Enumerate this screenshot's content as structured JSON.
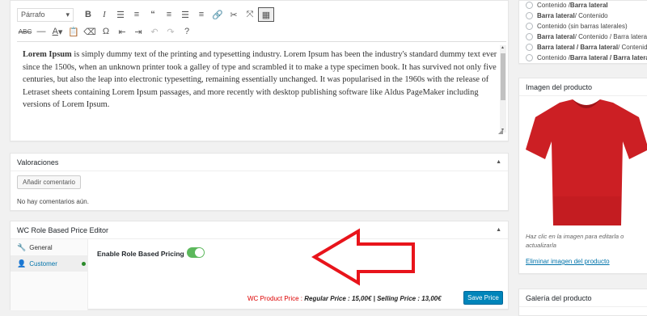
{
  "editor": {
    "format_select": "Párrafo",
    "content_bold": "Lorem Ipsum",
    "content_rest": " is simply dummy text of the printing and typesetting industry. Lorem Ipsum has been the industry's standard dummy text ever since the 1500s, when an unknown printer took a galley of type and scrambled it to make a type specimen book. It has survived not only five centuries, but also the leap into electronic typesetting, remaining essentially unchanged. It was popularised in the 1960s with the release of Letraset sheets containing Lorem Ipsum passages, and more recently with desktop publishing software like Aldus PageMaker including versions of Lorem Ipsum.",
    "toolbar_row1": [
      "bold-icon",
      "italic-icon",
      "bulleted-list-icon",
      "numbered-list-icon",
      "blockquote-icon",
      "align-left-icon",
      "align-center-icon",
      "align-right-icon",
      "link-icon",
      "unlink-icon",
      "fullscreen-icon",
      "toolbar-toggle-icon"
    ],
    "toolbar_row2": [
      "strikethrough-icon",
      "horizontal-line-icon",
      "text-color-icon",
      "paste-text-icon",
      "clear-formatting-icon",
      "special-char-icon",
      "outdent-icon",
      "indent-icon",
      "undo-icon",
      "redo-icon",
      "help-icon"
    ]
  },
  "reviews": {
    "title": "Valoraciones",
    "add_button": "Añadir comentario",
    "empty_text": "No hay comentarios aún."
  },
  "role_price": {
    "title": "WC Role Based Price Editor",
    "tabs": [
      {
        "label": "General",
        "icon": "wrench-icon"
      },
      {
        "label": "Customer",
        "icon": "user-icon"
      }
    ],
    "enable_label": "Enable Role Based Pricing",
    "enabled": true,
    "price_prefix": "WC Product Price : ",
    "price_detail": "Regular Price : 15,00€ | Selling Price : 13,00€",
    "save_button": "Save Price"
  },
  "templates": {
    "options": [
      {
        "a": "Contenido / ",
        "b": "Barra lateral"
      },
      {
        "a": "Barra lateral",
        "b": " / Contenido"
      },
      {
        "a": "Contenido (sin barras laterales)",
        "b": ""
      },
      {
        "a": "Barra lateral",
        "b": " / Contenido / Barra lateral"
      },
      {
        "a": "Barra lateral / Barra lateral",
        "b": " / Contenido"
      },
      {
        "a": "Contenido / ",
        "b": "Barra lateral / Barra lateral"
      }
    ]
  },
  "product_image": {
    "title": "Imagen del producto",
    "help_text": "Haz clic en la imagen para editarla o actualizarla",
    "remove_link": "Eliminar imagen del producto"
  },
  "gallery": {
    "title": "Galería del producto"
  },
  "colors": {
    "accent": "#0085ba",
    "link": "#0073aa",
    "price": "#dd0000",
    "toggle": "#5cb85c",
    "shirt": "#cc1f24",
    "annotation": "#e8141b"
  }
}
